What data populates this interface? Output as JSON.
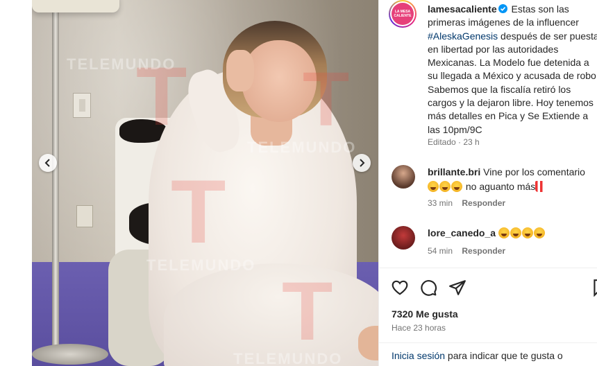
{
  "post": {
    "username": "lamesacaliente",
    "brand_logo_text": "LA MESA CALIENTE",
    "caption_before_hashtag": " Estas son las primeras imágenes de la influencer ",
    "hashtag": "#AleskaGenesis",
    "caption_after_hashtag": " después de ser puesta en libertad por las autoridades Mexicanas. La Modelo fue detenida a su llegada a México y acusada de robo. Sabemos que la fiscalía retiró los cargos y la dejaron libre. Hoy tenemos más detalles en Pica y Se Extiende a las 10pm/9C",
    "edited_label": "Editado · 23 h"
  },
  "photo": {
    "watermark": "TELEMUNDO"
  },
  "comments": [
    {
      "username": "brillante.bri",
      "text": " Vine por los comentario",
      "text_line2": " no aguanto más",
      "time": "33 min",
      "reply": "Responder"
    },
    {
      "username": "lore_canedo_a",
      "time": "54 min",
      "reply": "Responder"
    }
  ],
  "stats": {
    "likes": "7320 Me gusta",
    "time_ago": "Hace 23 horas"
  },
  "login": {
    "link": "Inicia sesión",
    "text": " para indicar que te gusta o"
  },
  "colors": {
    "verified": "#0095f6",
    "hashtag": "#00376b",
    "meta_gray": "#737373"
  },
  "icons": {
    "like": "heart-icon",
    "comment": "comment-icon",
    "share": "share-icon",
    "save": "bookmark-icon",
    "prev": "chevron-left-icon",
    "next": "chevron-right-icon"
  }
}
